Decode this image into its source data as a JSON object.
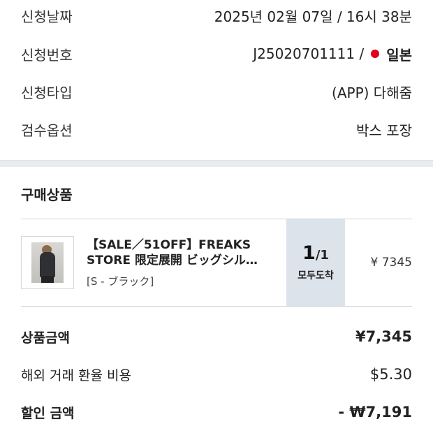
{
  "order_info": {
    "rows": [
      {
        "label": "신청날짜",
        "value": "2025년 02월 07일 / 16시 38분"
      },
      {
        "label": "신청번호",
        "value": "J25020701111 /",
        "country": "일본",
        "flag_color": "#e0001a"
      },
      {
        "label": "신청타입",
        "value": "(APP) 다해줌"
      },
      {
        "label": "검수옵션",
        "value": "박스 포장"
      }
    ]
  },
  "products": {
    "title": "구매상품",
    "items": [
      {
        "name": "【SALE／51OFF】FREAKS STORE 限定展開 ビッグシル…",
        "option": "[S - ブラック]",
        "qty_done": "1",
        "qty_total": "/1",
        "status": "모두도착",
        "price": "¥ 7345"
      }
    ]
  },
  "summary": {
    "product_amount_label": "상품금액",
    "product_amount_value": "¥7,345",
    "fx_fee_label": "해외 거래 환율 비용",
    "fx_fee_value": "$5.30",
    "discount_label": "할인 금액",
    "discount_value": "- ₩7,191"
  },
  "colors": {
    "accent_qty_bg": "#dde3ea",
    "divider": "#e9ebef"
  }
}
